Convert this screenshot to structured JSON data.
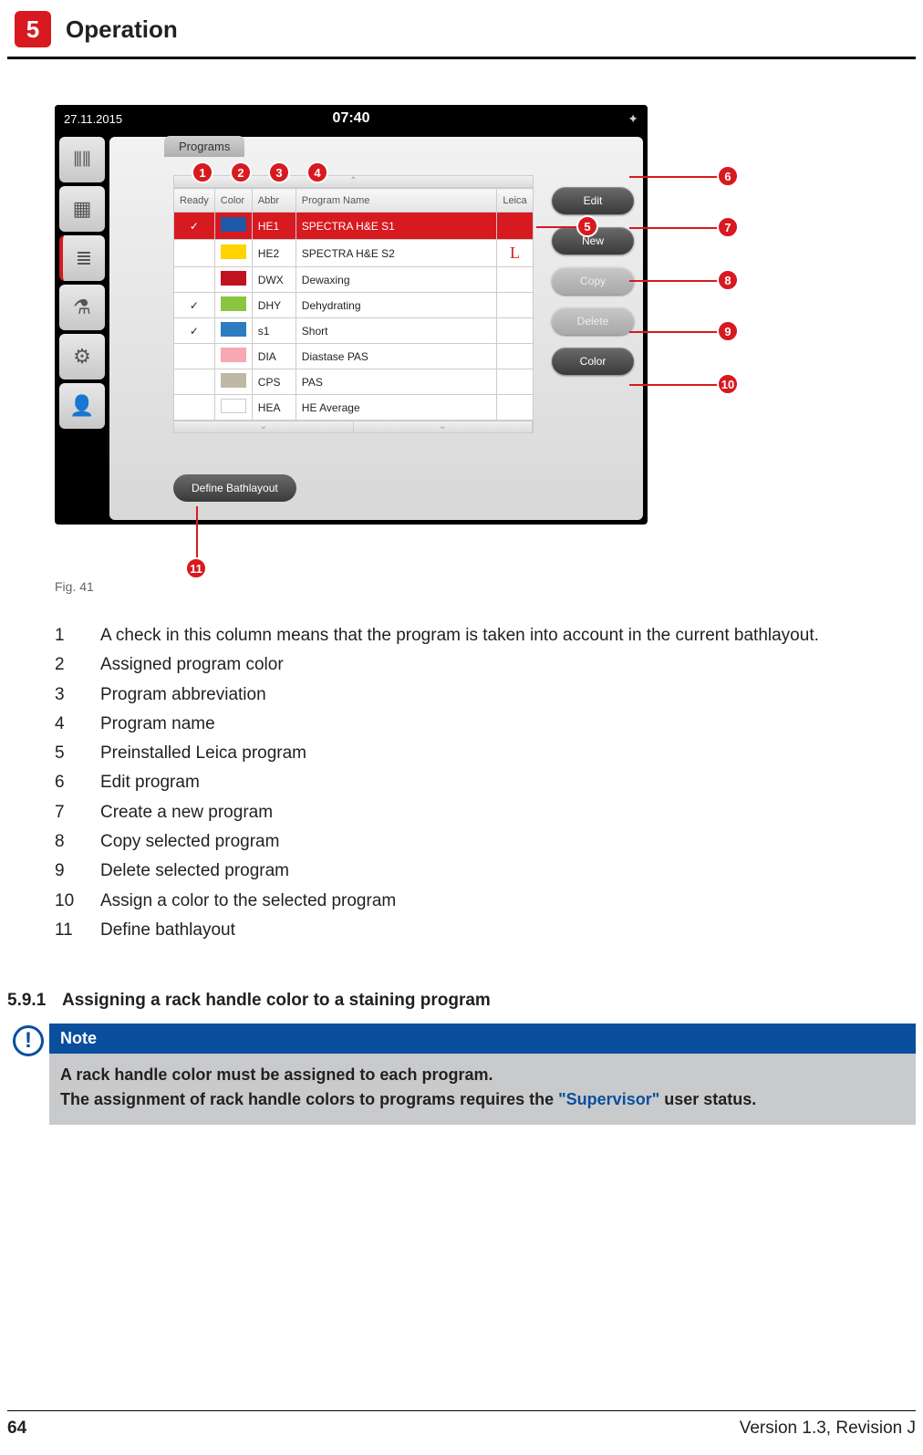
{
  "header": {
    "chapter_num": "5",
    "chapter_title": "Operation"
  },
  "screenshot": {
    "date": "27.11.2015",
    "time": "07:40",
    "tab_label": "Programs",
    "columns": {
      "ready": "Ready",
      "color": "Color",
      "abbr": "Abbr",
      "name": "Program Name",
      "leica": "Leica"
    },
    "rows": [
      {
        "ready": true,
        "color": "#1f5aa8",
        "abbr": "HE1",
        "name": "SPECTRA H&E S1",
        "leica": true,
        "selected": true
      },
      {
        "ready": false,
        "color": "#ffd400",
        "abbr": "HE2",
        "name": "SPECTRA H&E S2",
        "leica": true,
        "selected": false
      },
      {
        "ready": false,
        "color": "#c1121f",
        "abbr": "DWX",
        "name": "Dewaxing",
        "leica": false,
        "selected": false
      },
      {
        "ready": true,
        "color": "#8bc53f",
        "abbr": "DHY",
        "name": "Dehydrating",
        "leica": false,
        "selected": false
      },
      {
        "ready": true,
        "color": "#2d7cc1",
        "abbr": "s1",
        "name": "Short",
        "leica": false,
        "selected": false
      },
      {
        "ready": false,
        "color": "#f7a8b0",
        "abbr": "DIA",
        "name": "Diastase PAS",
        "leica": false,
        "selected": false
      },
      {
        "ready": false,
        "color": "#bfb8a5",
        "abbr": "CPS",
        "name": "PAS",
        "leica": false,
        "selected": false
      },
      {
        "ready": false,
        "color": "#ffffff",
        "abbr": "HEA",
        "name": "HE Average",
        "leica": false,
        "selected": false
      }
    ],
    "buttons": {
      "edit": "Edit",
      "new": "New",
      "copy": "Copy",
      "delete": "Delete",
      "color": "Color"
    },
    "define": "Define Bathlayout"
  },
  "figure_caption": "Fig. 41",
  "legend": [
    {
      "n": "1",
      "t": "A check in this column means that the program is taken into account in the current bathlayout."
    },
    {
      "n": "2",
      "t": "Assigned program color"
    },
    {
      "n": "3",
      "t": "Program abbreviation"
    },
    {
      "n": "4",
      "t": "Program name"
    },
    {
      "n": "5",
      "t": "Preinstalled Leica program"
    },
    {
      "n": "6",
      "t": "Edit program"
    },
    {
      "n": "7",
      "t": "Create a new program"
    },
    {
      "n": "8",
      "t": "Copy selected program"
    },
    {
      "n": "9",
      "t": "Delete selected program"
    },
    {
      "n": "10",
      "t": "Assign a color to the selected program"
    },
    {
      "n": "11",
      "t": "Define bathlayout"
    }
  ],
  "section": {
    "num": "5.9.1",
    "title": "Assigning a rack handle color to a staining program"
  },
  "note": {
    "label": "Note",
    "line1": "A rack handle color must be assigned to each program.",
    "line2a": "The assignment of rack handle colors to programs requires the ",
    "line2kw": "\"Supervisor\"",
    "line2b": " user status."
  },
  "footer": {
    "page": "64",
    "version": "Version 1.3, Revision J"
  },
  "callout_labels": {
    "c1": "1",
    "c2": "2",
    "c3": "3",
    "c4": "4",
    "c5": "5",
    "c6": "6",
    "c7": "7",
    "c8": "8",
    "c9": "9",
    "c10": "10",
    "c11": "11"
  }
}
